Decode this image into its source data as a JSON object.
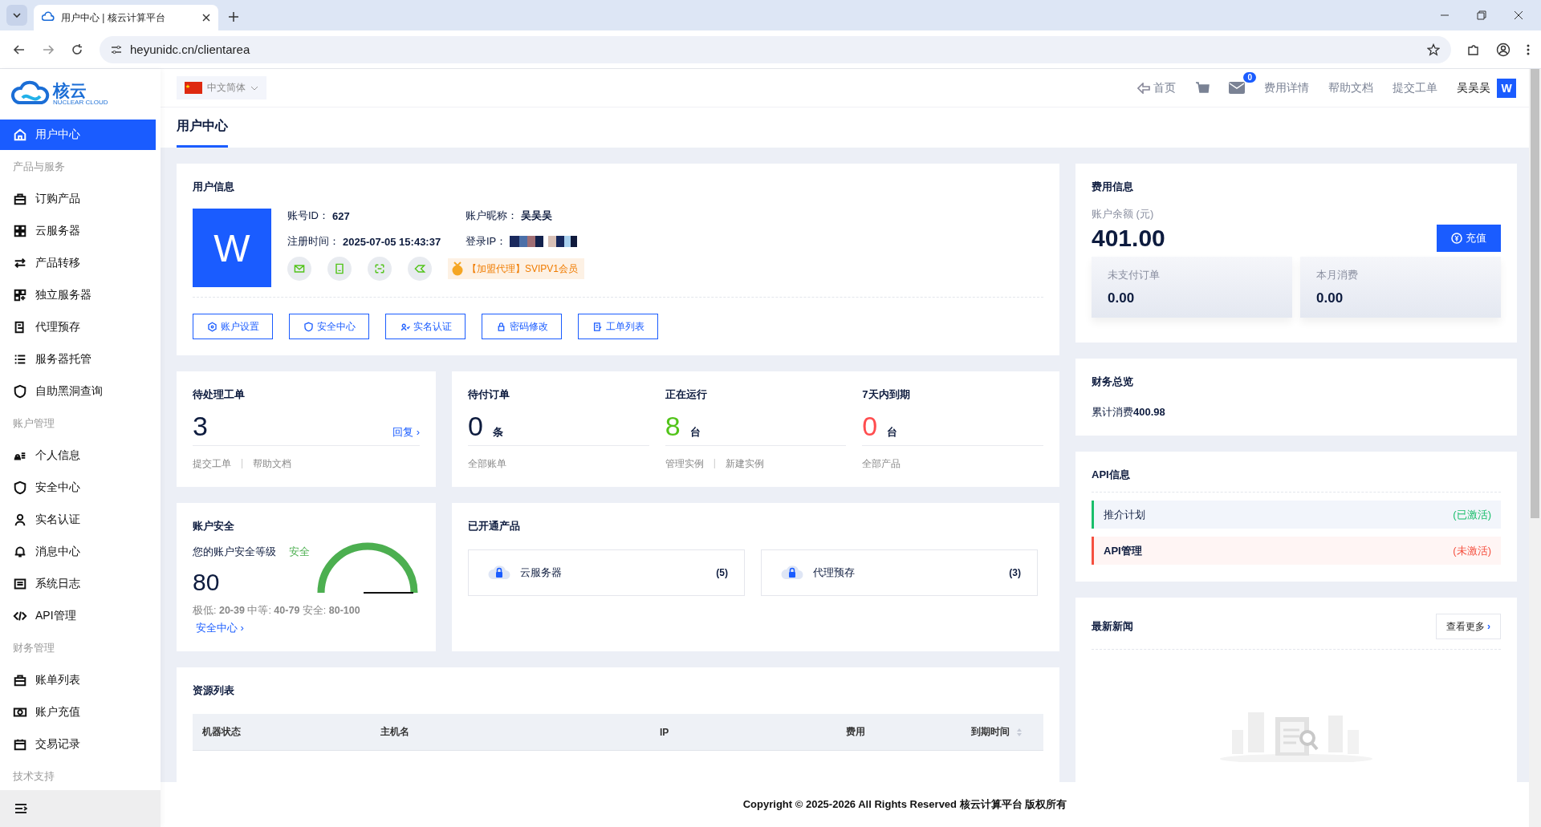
{
  "browser": {
    "tab_title": "用户中心 | 核云计算平台",
    "url": "heyunidc.cn/clientarea"
  },
  "sidebar": {
    "logo_text": "核云",
    "logo_sub": "NUCLEAR CLOUD",
    "entries": [
      {
        "kind": "item",
        "label": "用户中心",
        "selected": true
      },
      {
        "kind": "group",
        "label": "产品与服务"
      },
      {
        "kind": "item",
        "label": "订购产品",
        "selected": false
      },
      {
        "kind": "item",
        "label": "云服务器",
        "selected": false
      },
      {
        "kind": "item",
        "label": "产品转移",
        "selected": false
      },
      {
        "kind": "item",
        "label": "独立服务器",
        "selected": false
      },
      {
        "kind": "item",
        "label": "代理预存",
        "selected": false
      },
      {
        "kind": "item",
        "label": "服务器托管",
        "selected": false
      },
      {
        "kind": "item",
        "label": "自助黑洞查询",
        "selected": false
      },
      {
        "kind": "group",
        "label": "账户管理"
      },
      {
        "kind": "item",
        "label": "个人信息",
        "selected": false
      },
      {
        "kind": "item",
        "label": "安全中心",
        "selected": false
      },
      {
        "kind": "item",
        "label": "实名认证",
        "selected": false
      },
      {
        "kind": "item",
        "label": "消息中心",
        "selected": false
      },
      {
        "kind": "item",
        "label": "系统日志",
        "selected": false
      },
      {
        "kind": "item",
        "label": "API管理",
        "selected": false
      },
      {
        "kind": "group",
        "label": "财务管理"
      },
      {
        "kind": "item",
        "label": "账单列表",
        "selected": false
      },
      {
        "kind": "item",
        "label": "账户充值",
        "selected": false
      },
      {
        "kind": "item",
        "label": "交易记录",
        "selected": false
      },
      {
        "kind": "group",
        "label": "技术支持"
      }
    ]
  },
  "header": {
    "language": "中文简体",
    "home": "首页",
    "mail_badge": "0",
    "links": [
      "费用详情",
      "帮助文档",
      "提交工单"
    ],
    "user_name": "吴吴吴",
    "avatar": "W"
  },
  "page_title": "用户中心",
  "user_info": {
    "title": "用户信息",
    "avatar": "W",
    "fields": [
      {
        "label": "账号ID：",
        "value": "627"
      },
      {
        "label": "账户昵称：",
        "value": "吴吴吴"
      },
      {
        "label": "注册时间：",
        "value": "2025-07-05 15:43:37"
      },
      {
        "label": "登录IP："
      }
    ],
    "member_badge": "【加盟代理】SVIPV1会员",
    "buttons": [
      "账户设置",
      "安全中心",
      "实名认证",
      "密码修改",
      "工单列表"
    ]
  },
  "fees": {
    "title": "费用信息",
    "balance_label": "账户余额 (元)",
    "balance": "401.00",
    "recharge": "充值",
    "tiles": [
      {
        "label": "未支付订单",
        "value": "0.00"
      },
      {
        "label": "本月消费",
        "value": "0.00"
      }
    ]
  },
  "tickets": {
    "title": "待处理工单",
    "count": "3",
    "reply": "回复 ›",
    "separator": "|",
    "links": [
      "提交工单",
      "帮助文档"
    ]
  },
  "stats": [
    {
      "title": "待付订单",
      "value": "0",
      "unit": "条",
      "color": "#0d1b3e",
      "links": [
        "全部账单"
      ]
    },
    {
      "title": "正在运行",
      "value": "8",
      "unit": "台",
      "color": "#52c41a",
      "separator": "|",
      "links": [
        "管理实例",
        "新建实例"
      ]
    },
    {
      "title": "7天内到期",
      "value": "0",
      "unit": "台",
      "color": "#ff4d4f",
      "links": [
        "全部产品"
      ]
    }
  ],
  "security": {
    "title": "账户安全",
    "prompt": "您的账户安全等级",
    "grade": "安全",
    "score": "80",
    "level": 1,
    "legend": "极低: **20-39** 中等: **40-79** 安全: **80-100**",
    "link": "安全中心 ›"
  },
  "products": {
    "title": "已开通产品",
    "items": [
      {
        "name": "云服务器",
        "count": "(5)"
      },
      {
        "name": "代理预存",
        "count": "(3)"
      }
    ]
  },
  "finance": {
    "title": "财务总览",
    "text": "累计消费**400.98**"
  },
  "api": {
    "title": "API信息",
    "items": [
      {
        "name": "推介计划",
        "status": "(已激活)",
        "active": true
      },
      {
        "name": "API管理",
        "status": "(未激活)",
        "active": false
      }
    ]
  },
  "news": {
    "title": "最新新闻",
    "more": "查看更多",
    "more_chevron": "›"
  },
  "resources": {
    "title": "资源列表",
    "columns": [
      "机器状态",
      "主机名",
      "IP",
      "费用",
      "到期时间"
    ]
  },
  "footer": "Copyright © 2025-2026 All Rights Reserved 核云计算平台 版权所有"
}
